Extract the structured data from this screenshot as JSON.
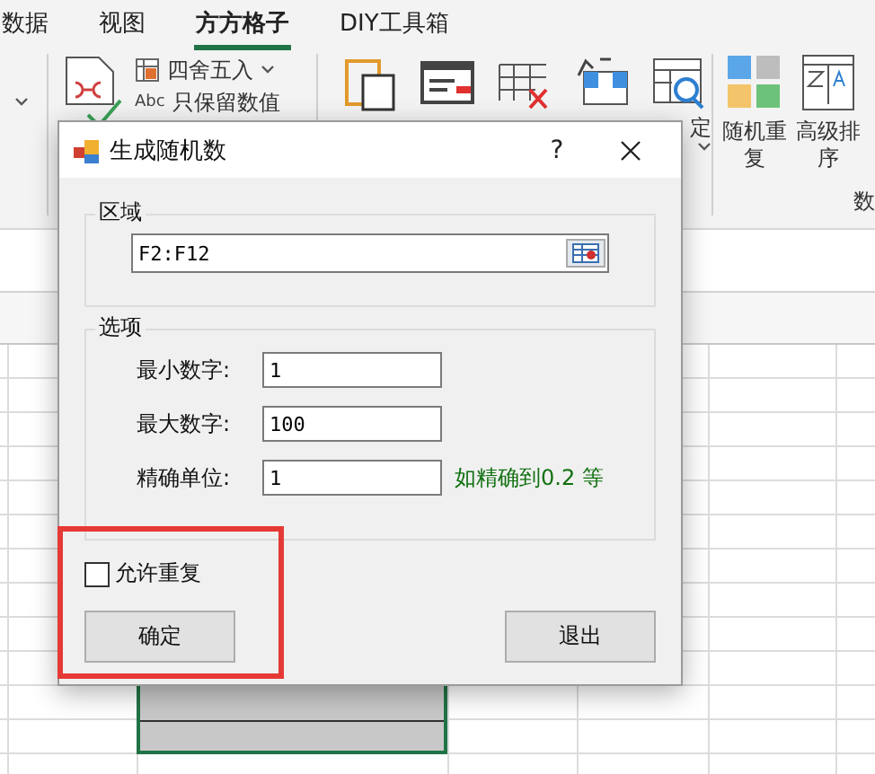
{
  "ribbon_tabs": [
    {
      "label": "数据",
      "selected": false
    },
    {
      "label": "视图",
      "selected": false
    },
    {
      "label": "方方格子",
      "selected": true
    },
    {
      "label": "DIY工具箱",
      "selected": false
    }
  ],
  "ribbon": {
    "rounding_dropdown": "四舍五入",
    "abc_tag": "Abc",
    "keep_values": "只保留数值",
    "tool_label": "定",
    "random_repeat": "随机重复",
    "advanced_sort": "高级排序",
    "group_label": "数"
  },
  "dialog": {
    "title": "生成随机数",
    "help": "?",
    "range_group": {
      "title": "区域",
      "value": "F2:F12"
    },
    "options_group": {
      "title": "选项",
      "fields": [
        {
          "label": "最小数字:",
          "value": "1"
        },
        {
          "label": "最大数字:",
          "value": "100"
        },
        {
          "label": "精确单位:",
          "value": "1",
          "hint": "如精确到0.2 等"
        }
      ]
    },
    "allow_repeat": {
      "label": "允许重复",
      "checked": false
    },
    "buttons": [
      {
        "label": "确定"
      },
      {
        "label": "退出"
      }
    ]
  }
}
